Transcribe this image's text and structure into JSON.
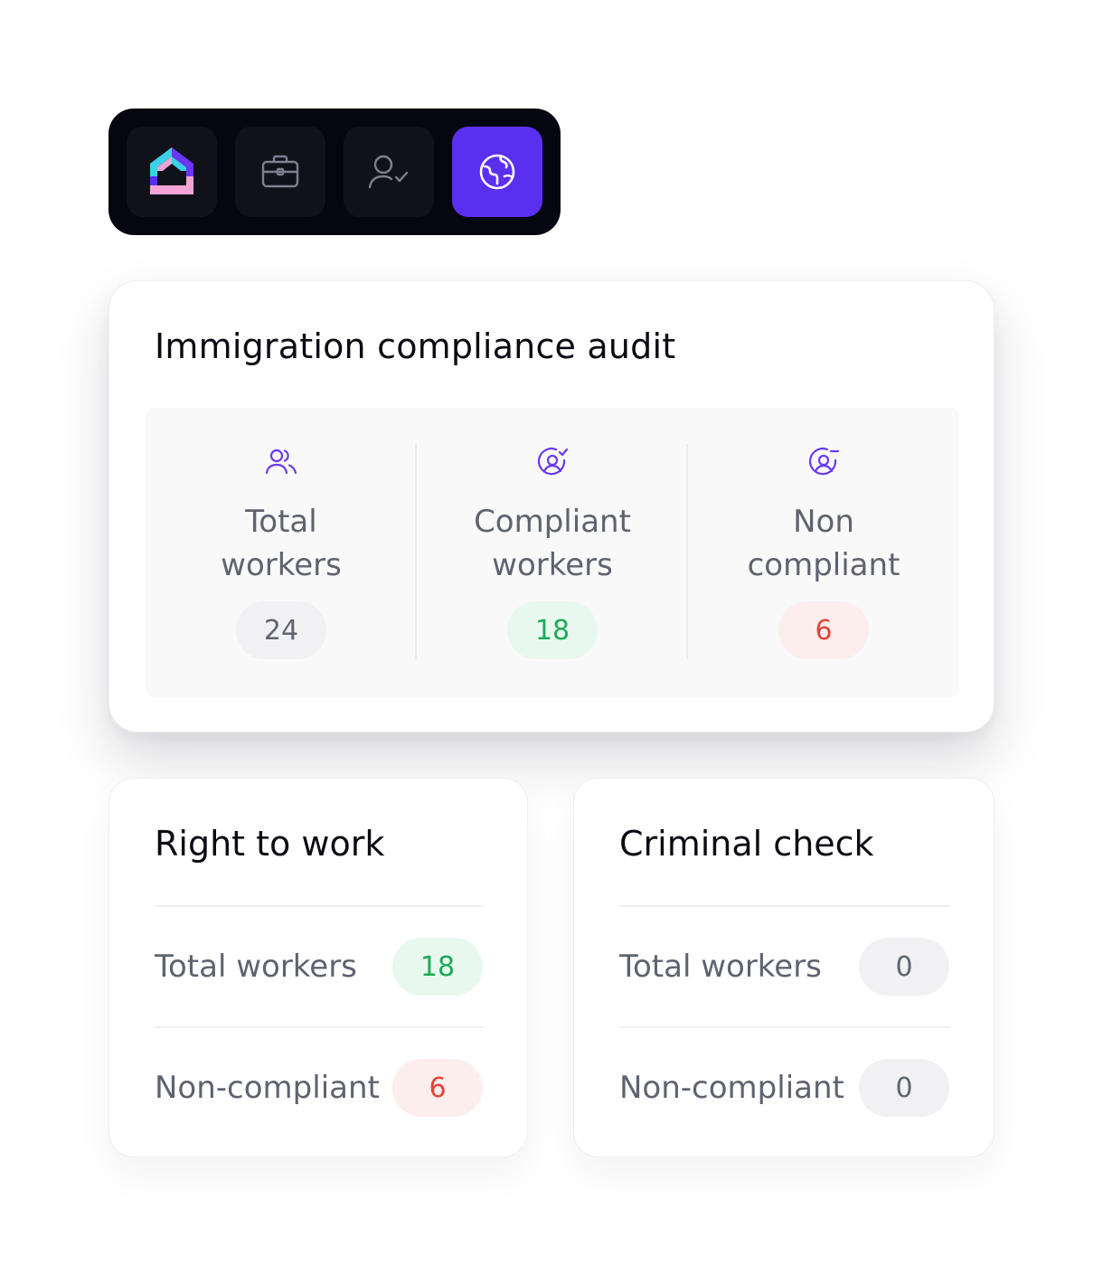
{
  "iconbar": {
    "items": [
      {
        "icon": "home-logo-icon"
      },
      {
        "icon": "briefcase-icon"
      },
      {
        "icon": "user-check-icon"
      },
      {
        "icon": "globe-icon",
        "active": true
      }
    ],
    "accent": "#5b2ff0"
  },
  "audit": {
    "title": "Immigration compliance audit",
    "stats": [
      {
        "icon": "users-icon",
        "label": "Total\nworkers",
        "value": "24",
        "tone": "gray"
      },
      {
        "icon": "user-check-circle-icon",
        "label": "Compliant\nworkers",
        "value": "18",
        "tone": "green"
      },
      {
        "icon": "user-minus-circle-icon",
        "label": "Non\ncompliant",
        "value": "6",
        "tone": "red"
      }
    ]
  },
  "right_to_work": {
    "title": "Right to work",
    "rows": [
      {
        "label": "Total workers",
        "value": "18",
        "tone": "green"
      },
      {
        "label": "Non-compliant",
        "value": "6",
        "tone": "red"
      }
    ]
  },
  "criminal_check": {
    "title": "Criminal check",
    "rows": [
      {
        "label": "Total workers",
        "value": "0",
        "tone": "gray"
      },
      {
        "label": "Non-compliant",
        "value": "0",
        "tone": "gray"
      }
    ]
  },
  "colors": {
    "green": "#1faa59",
    "red": "#e5443b",
    "purple": "#5b2ff0"
  }
}
